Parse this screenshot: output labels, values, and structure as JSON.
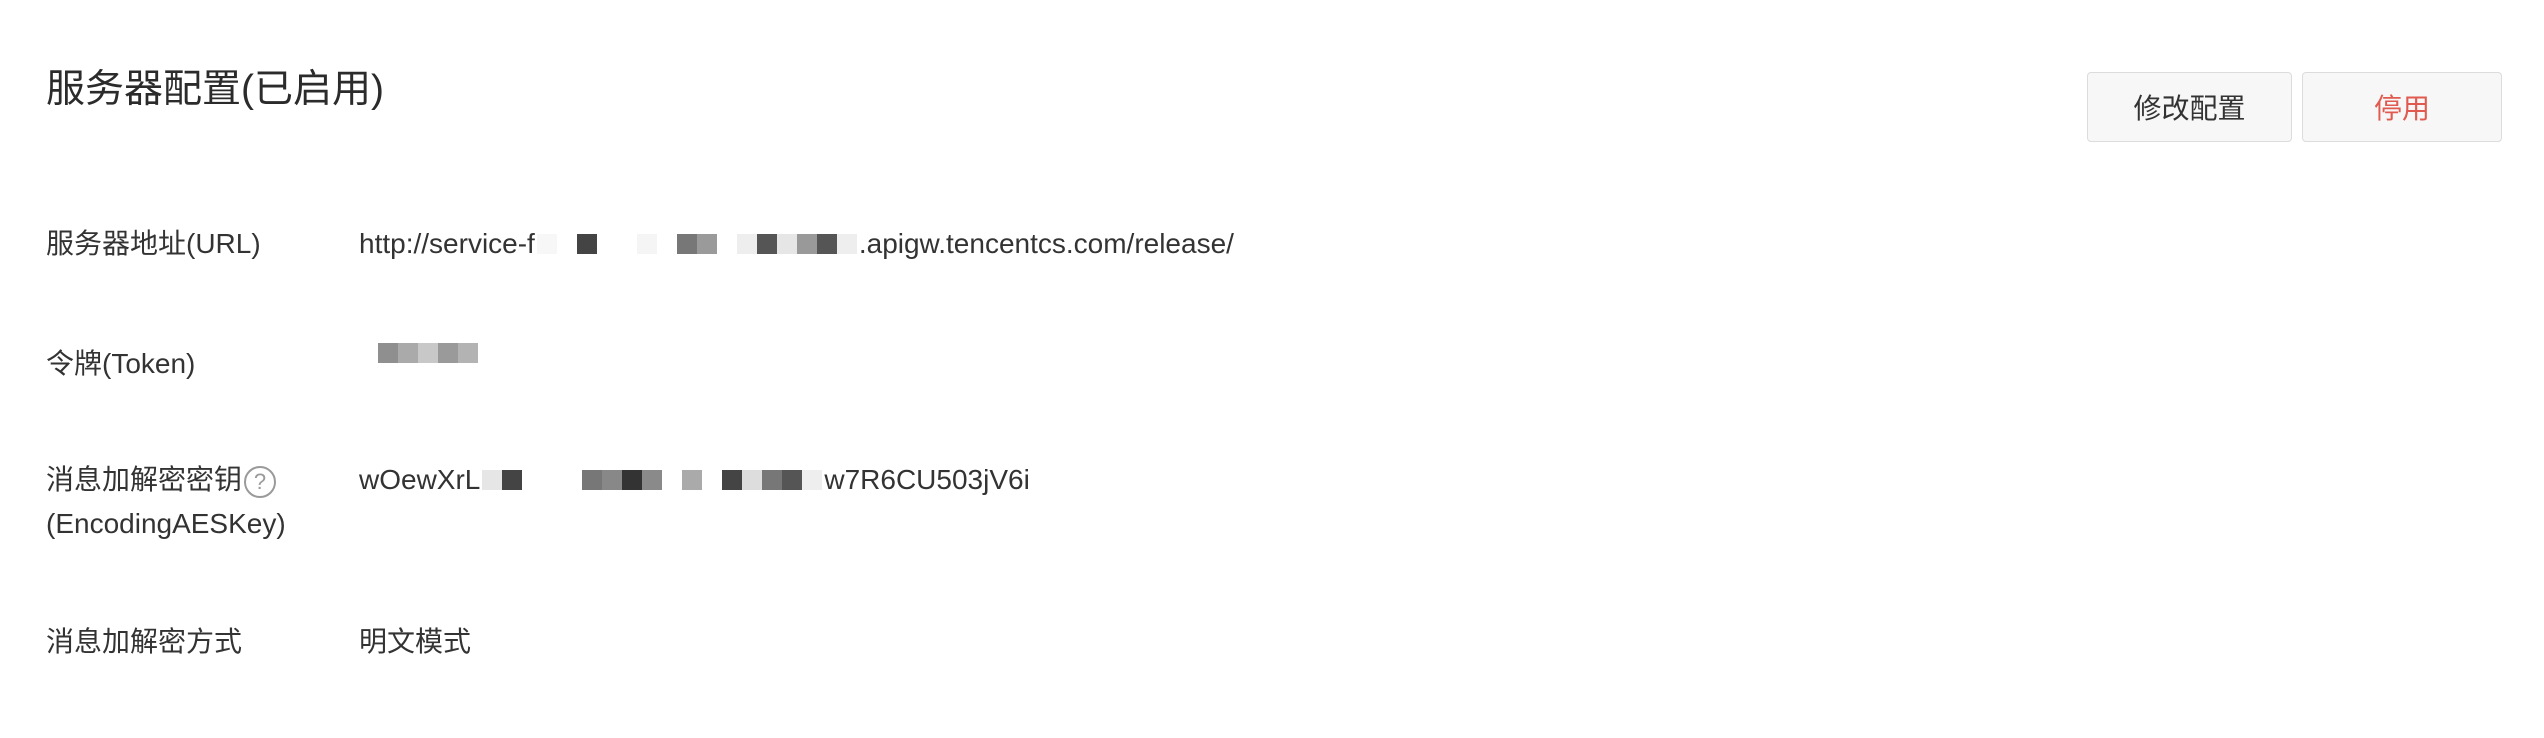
{
  "header": {
    "title": "服务器配置(已启用)",
    "edit_label": "修改配置",
    "disable_label": "停用"
  },
  "rows": {
    "url": {
      "label": "服务器地址(URL)",
      "value_prefix": "http://service-f",
      "value_suffix": ".apigw.tencentcs.com/release/"
    },
    "token": {
      "label": "令牌(Token)"
    },
    "aes_key": {
      "label_line1": "消息加解密密钥",
      "label_line2": "(EncodingAESKey)",
      "value_prefix": "wOewXrL",
      "value_suffix": "w7R6CU503jV6i"
    },
    "mode": {
      "label": "消息加解密方式",
      "value": "明文模式"
    }
  },
  "icons": {
    "help": "question-circle-icon"
  },
  "colors": {
    "title_text": "#2b2b2b",
    "body_text": "#333333",
    "danger": "#e05a4f",
    "button_border": "#dcdcdc",
    "button_bg": "#f7f7f7",
    "help_icon": "#9a9a9a"
  }
}
